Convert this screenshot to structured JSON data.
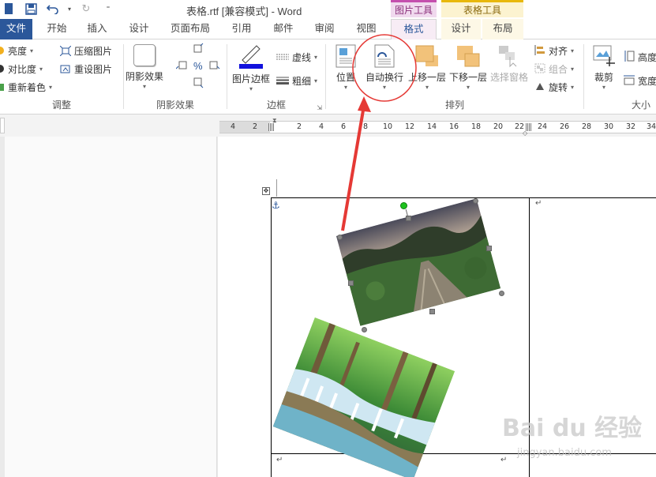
{
  "window": {
    "title": "表格.rtf [兼容模式] - Word",
    "context_headers": {
      "picture_tools": "图片工具",
      "table_tools": "表格工具"
    }
  },
  "tabs": {
    "file": "文件",
    "home": "开始",
    "insert": "插入",
    "design": "设计",
    "layout": "页面布局",
    "references": "引用",
    "mailings": "邮件",
    "review": "审阅",
    "view": "视图",
    "format": "格式",
    "table_design": "设计",
    "table_layout": "布局"
  },
  "ribbon": {
    "adjust": {
      "brightness": "亮度",
      "contrast": "对比度",
      "recolor": "重新着色",
      "compress": "压缩图片",
      "reset": "重设图片",
      "label": "调整"
    },
    "shadow": {
      "shadow_effects": "阴影效果",
      "label": "阴影效果"
    },
    "border": {
      "picture_border": "图片边框",
      "dashes": "虚线",
      "weight": "粗细",
      "label": "边框"
    },
    "arrange": {
      "position": "位置",
      "wrap_text": "自动换行",
      "bring_forward": "上移一层",
      "send_backward": "下移一层",
      "selection_pane": "选择窗格",
      "align": "对齐",
      "group": "组合",
      "rotate": "旋转",
      "label": "排列"
    },
    "size": {
      "crop": "裁剪",
      "height": "高度",
      "width": "宽度",
      "label": "大小"
    }
  },
  "ruler": {
    "left_numbers": [
      "4",
      "2"
    ],
    "right_numbers": [
      "2",
      "4",
      "6",
      "8",
      "10",
      "12",
      "14",
      "16",
      "18",
      "20",
      "22",
      "24",
      "26",
      "28",
      "30",
      "32",
      "34"
    ]
  },
  "watermark": {
    "brand": "Bai du 经验",
    "url": "jingyan.baidu.com"
  },
  "colors": {
    "file_tab": "#2b579a",
    "picture_tools": "#c44fae",
    "table_tools": "#e8b80c",
    "annotation": "#e53935"
  }
}
